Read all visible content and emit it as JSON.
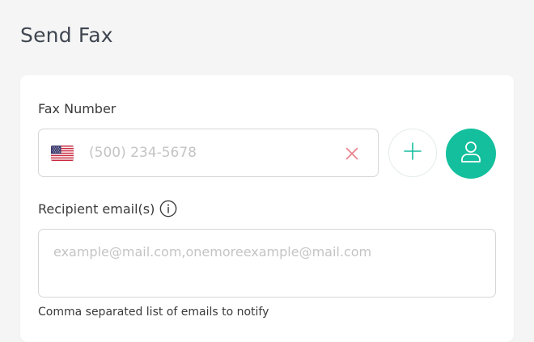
{
  "page": {
    "title": "Send Fax"
  },
  "fax_number": {
    "label": "Fax Number",
    "placeholder": "(500) 234-5678",
    "value": "",
    "country_flag": "us-flag-icon",
    "clear_icon": "close-icon",
    "add_icon": "plus-icon",
    "contacts_icon": "user-icon"
  },
  "recipient_emails": {
    "label": "Recipient email(s)",
    "info_icon": "info-icon",
    "placeholder": "example@mail.com,onemoreexample@mail.com",
    "value": "",
    "helper": "Comma separated list of emails to notify"
  },
  "colors": {
    "accent": "#14bf9d",
    "clear": "#e8808a",
    "background": "#f5f5f5",
    "card": "#ffffff"
  }
}
